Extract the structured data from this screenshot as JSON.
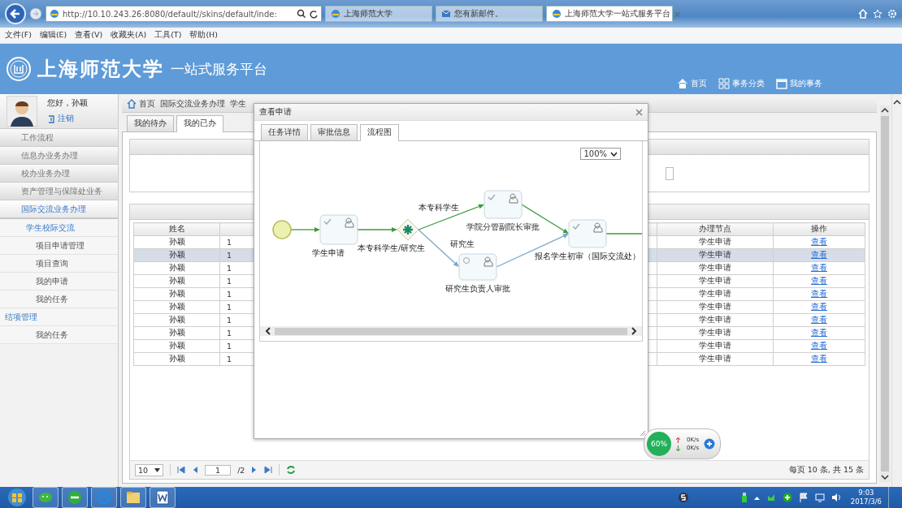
{
  "browser": {
    "address": "http://10.10.243.26:8080/default//skins/default/inde:",
    "tabs": [
      {
        "title": "上海师范大学",
        "kind": "page",
        "selected": false
      },
      {
        "title": "您有新邮件。",
        "kind": "mail",
        "selected": false
      },
      {
        "title": "上海师范大学一站式服务平台",
        "kind": "page",
        "selected": true,
        "close": "×"
      }
    ]
  },
  "menu_bar": [
    "文件(F)",
    "编辑(E)",
    "查看(V)",
    "收藏夹(A)",
    "工具(T)",
    "帮助(H)"
  ],
  "header": {
    "logo_text": "上海师范大学",
    "subtitle": "一站式服务平台",
    "nav": [
      {
        "label": "首页",
        "kind": "home"
      },
      {
        "label": "事务分类",
        "kind": "grid"
      },
      {
        "label": "我的事务",
        "kind": "window"
      }
    ]
  },
  "user": {
    "greeting": "您好，孙颖",
    "logout": "注销"
  },
  "sidebar": {
    "items": [
      {
        "label": "工作流程",
        "selected": false,
        "expanded": false
      },
      {
        "label": "信息办业务办理",
        "selected": false,
        "expanded": false
      },
      {
        "label": "校办业务办理",
        "selected": false,
        "expanded": false
      },
      {
        "label": "资产管理与保障处业务",
        "selected": false,
        "expanded": false
      },
      {
        "label": "国际交流业务办理",
        "selected": true,
        "expanded": true,
        "children": [
          {
            "label": "学生校际交流",
            "children": [
              {
                "label": "项目申请管理"
              },
              {
                "label": "项目查询"
              },
              {
                "label": "我的申请"
              },
              {
                "label": "我的任务"
              }
            ]
          },
          {
            "label": "结项管理",
            "children": [
              {
                "label": "我的任务"
              }
            ]
          }
        ]
      }
    ]
  },
  "breadcrumb": [
    "首页",
    "国际交流业务办理",
    "学生"
  ],
  "tabs": [
    {
      "label": "我的待办",
      "selected": false
    },
    {
      "label": "我的已办",
      "selected": true
    }
  ],
  "table": {
    "columns": [
      "姓名",
      "办理节点",
      "操作"
    ],
    "rows": [
      {
        "name": "孙颖",
        "column_2": "1",
        "node": "学生申请",
        "action": "查看",
        "selected": false
      },
      {
        "name": "孙颖",
        "column_2": "1",
        "node": "学生申请",
        "action": "查看",
        "selected": true
      },
      {
        "name": "孙颖",
        "column_2": "1",
        "node": "学生申请",
        "action": "查看",
        "selected": false
      },
      {
        "name": "孙颖",
        "column_2": "1",
        "node": "学生申请",
        "action": "查看",
        "selected": false
      },
      {
        "name": "孙颖",
        "column_2": "1",
        "node": "学生申请",
        "action": "查看",
        "selected": false
      },
      {
        "name": "孙颖",
        "column_2": "1",
        "node": "学生申请",
        "action": "查看",
        "selected": false
      },
      {
        "name": "孙颖",
        "column_2": "1",
        "node": "学生申请",
        "action": "查看",
        "selected": false
      },
      {
        "name": "孙颖",
        "column_2": "1",
        "node": "学生申请",
        "action": "查看",
        "selected": false
      },
      {
        "name": "孙颖",
        "column_2": "1",
        "node": "学生申请",
        "action": "查看",
        "selected": false
      },
      {
        "name": "孙颖",
        "column_2": "1",
        "node": "学生申请",
        "action": "查看",
        "selected": false
      }
    ]
  },
  "pager": {
    "page_size": "10",
    "page": "1",
    "total_pages": "/2",
    "summary": "每页 10 条, 共 15 条"
  },
  "dialog": {
    "title": "查看申请",
    "tabs": [
      {
        "label": "任务详情",
        "selected": false
      },
      {
        "label": "审批信息",
        "selected": false
      },
      {
        "label": "流程图",
        "selected": true
      }
    ],
    "zoom": "100%",
    "diagram": {
      "nodes": [
        {
          "kind": "start"
        },
        {
          "kind": "task",
          "label": "学生申请",
          "completed": true
        },
        {
          "kind": "gateway",
          "label": "本专科学生/研究生"
        },
        {
          "kind": "task",
          "label": "学院分管副院长审批",
          "completed": true
        },
        {
          "kind": "task",
          "label": "研究生负责人审批",
          "completed": false
        },
        {
          "kind": "task",
          "label": "报名学生初审（国际交流处）",
          "completed": true
        }
      ],
      "edges": [
        {
          "taken": true
        },
        {
          "taken": true
        },
        {
          "taken": true,
          "label": "本专科学生"
        },
        {
          "taken": false,
          "label": "研究生"
        },
        {
          "taken": true
        },
        {
          "taken": false
        },
        {
          "taken": true
        }
      ]
    }
  },
  "widget": {
    "percent": "60%",
    "upload": "0K/s",
    "download": "0K/s"
  },
  "taskbar": {
    "time": "9:03",
    "date": "2017/3/6"
  }
}
